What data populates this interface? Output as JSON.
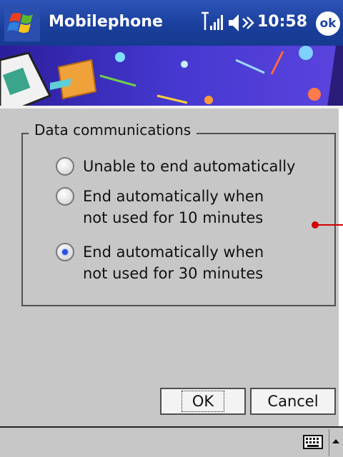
{
  "titlebar": {
    "app_title": "Mobilephone",
    "time": "10:58",
    "ok_label": "ok",
    "icons": [
      "windows-start-icon",
      "signal-icon",
      "speaker-icon"
    ]
  },
  "dialog": {
    "group_label": "Data communications",
    "options": [
      {
        "line1": "Unable to end automatically",
        "line2": "",
        "checked": false
      },
      {
        "line1": "End automatically when",
        "line2": "not used for 10 minutes",
        "checked": false
      },
      {
        "line1": "End automatically when",
        "line2": "not used for 30 minutes",
        "checked": true
      }
    ],
    "buttons": {
      "ok": "OK",
      "cancel": "Cancel"
    }
  },
  "bottombar": {
    "icons": [
      "keyboard-icon",
      "sip-up-arrow-icon"
    ]
  },
  "colors": {
    "titlebar": "#1d45a4",
    "content_bg": "#c7c7c7",
    "radio_dot": "#2a4fe0",
    "marker": "#d40000"
  }
}
